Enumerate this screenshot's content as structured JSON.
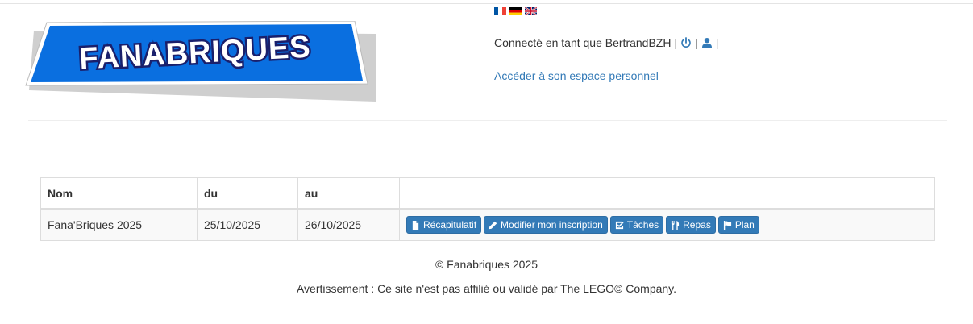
{
  "header": {
    "logo_text": "FANABRIQUES",
    "languages": [
      "fr-flag-icon",
      "de-flag-icon",
      "en-flag-icon"
    ],
    "connected_prefix": "Connecté en tant que BertrandBZH",
    "separator": "|",
    "logout_icon": "power-icon",
    "profile_icon": "user-icon",
    "personal_space_link": "Accéder à son espace personnel"
  },
  "table": {
    "headers": [
      "Nom",
      "du",
      "au",
      ""
    ],
    "rows": [
      {
        "nom": "Fana'Briques 2025",
        "du": "25/10/2025",
        "au": "26/10/2025",
        "actions": [
          {
            "label": "Récapitulatif",
            "icon": "file-icon"
          },
          {
            "label": "Modifier mon inscription",
            "icon": "pencil-icon"
          },
          {
            "label": "Tâches",
            "icon": "check-square-icon"
          },
          {
            "label": "Repas",
            "icon": "cutlery-icon"
          },
          {
            "label": "Plan",
            "icon": "flag-icon"
          }
        ]
      }
    ]
  },
  "footer": {
    "copyright": "© Fanabriques 2025",
    "disclaimer": "Avertissement : Ce site n'est pas affilié ou validé par The LEGO© Company."
  },
  "colors": {
    "primary": "#337ab7",
    "logo_blue": "#0a6fe0",
    "logo_text": "#1a1f6b"
  }
}
